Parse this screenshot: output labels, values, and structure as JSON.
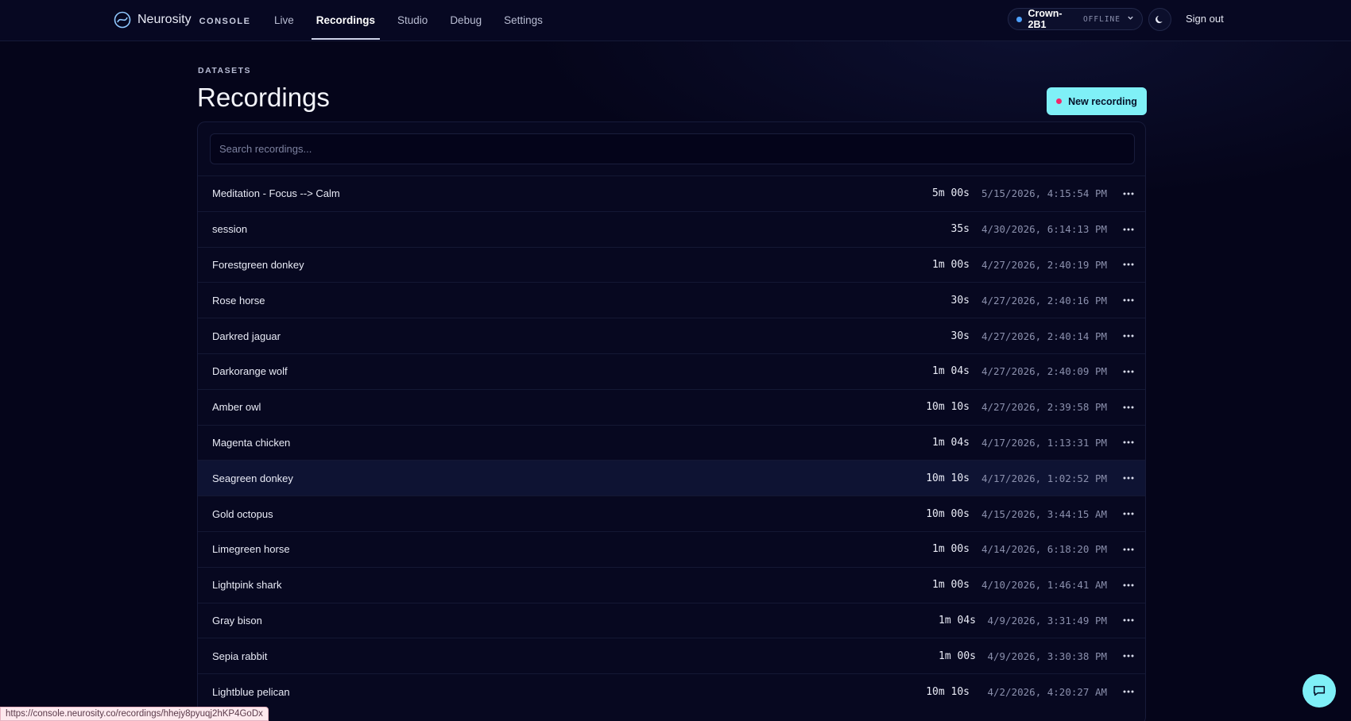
{
  "app": {
    "brand": "Neurosity",
    "brand_sub": "CONSOLE"
  },
  "nav": {
    "items": [
      {
        "label": "Live",
        "active": false
      },
      {
        "label": "Recordings",
        "active": true
      },
      {
        "label": "Studio",
        "active": false
      },
      {
        "label": "Debug",
        "active": false
      },
      {
        "label": "Settings",
        "active": false
      }
    ]
  },
  "device": {
    "name": "Crown-2B1",
    "status": "OFFLINE",
    "status_color": "#4ea1ff"
  },
  "header": {
    "sign_out": "Sign out",
    "theme_icon": "moon-icon"
  },
  "page": {
    "eyebrow": "DATASETS",
    "title": "Recordings",
    "new_button": "New recording"
  },
  "search": {
    "placeholder": "Search recordings..."
  },
  "recordings": [
    {
      "name": "Meditation - Focus --> Calm",
      "duration": "5m 00s",
      "timestamp": "5/15/2026, 4:15:54 PM"
    },
    {
      "name": "session",
      "duration": "35s",
      "timestamp": "4/30/2026, 6:14:13 PM"
    },
    {
      "name": "Forestgreen donkey",
      "duration": "1m 00s",
      "timestamp": "4/27/2026, 2:40:19 PM"
    },
    {
      "name": "Rose horse",
      "duration": "30s",
      "timestamp": "4/27/2026, 2:40:16 PM"
    },
    {
      "name": "Darkred jaguar",
      "duration": "30s",
      "timestamp": "4/27/2026, 2:40:14 PM"
    },
    {
      "name": "Darkorange wolf",
      "duration": "1m 04s",
      "timestamp": "4/27/2026, 2:40:09 PM"
    },
    {
      "name": "Amber owl",
      "duration": "10m 10s",
      "timestamp": "4/27/2026, 2:39:58 PM"
    },
    {
      "name": "Magenta chicken",
      "duration": "1m 04s",
      "timestamp": "4/17/2026, 1:13:31 PM"
    },
    {
      "name": "Seagreen donkey",
      "duration": "10m 10s",
      "timestamp": "4/17/2026, 1:02:52 PM",
      "highlighted": true
    },
    {
      "name": "Gold octopus",
      "duration": "10m 00s",
      "timestamp": "4/15/2026, 3:44:15 AM"
    },
    {
      "name": "Limegreen horse",
      "duration": "1m 00s",
      "timestamp": "4/14/2026, 6:18:20 PM"
    },
    {
      "name": "Lightpink shark",
      "duration": "1m 00s",
      "timestamp": "4/10/2026, 1:46:41 AM"
    },
    {
      "name": "Gray bison",
      "duration": "1m 04s",
      "timestamp": "4/9/2026, 3:31:49 PM",
      "short_ts": true
    },
    {
      "name": "Sepia rabbit",
      "duration": "1m 00s",
      "timestamp": "4/9/2026, 3:30:38 PM",
      "short_ts": true
    },
    {
      "name": "Lightblue pelican",
      "duration": "10m 10s",
      "timestamp": "4/2/2026, 4:20:27 AM"
    }
  ],
  "status_bar": {
    "url": "https://console.neurosity.co/recordings/hhejy8pyuqj2hKP4GoDx"
  },
  "colors": {
    "accent": "#7ff0f7",
    "record_dot": "#f2286b",
    "background": "#05051a"
  }
}
